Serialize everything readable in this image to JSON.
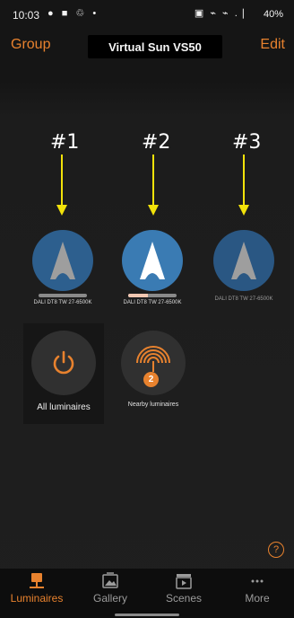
{
  "status_bar": {
    "time": "10:03",
    "left_icons": "● ■ ♲ •",
    "right_icons": "▣ ⌁ ⌁ .❘",
    "battery": "40%"
  },
  "header": {
    "group_label": "Group",
    "title": "Virtual Sun VS50",
    "edit_label": "Edit"
  },
  "annotations": [
    {
      "label": "#1"
    },
    {
      "label": "#2"
    },
    {
      "label": "#3"
    }
  ],
  "annotation_color": "#f2e20a",
  "luminaires": [
    {
      "label": "DALI DT8 TW 27-6500K",
      "level": 0.0,
      "state": "off",
      "icon": "luminaire-shape-icon"
    },
    {
      "label": "DALI DT8 TW 27-6500K",
      "level": 0.4,
      "state": "on",
      "icon": "luminaire-shape-icon"
    },
    {
      "label": "DALI DT8 TW 27-6500K",
      "level": null,
      "state": "unreachable",
      "icon": "luminaire-shape-icon"
    }
  ],
  "all_luminaires": {
    "label": "All luminaires",
    "icon": "power-icon"
  },
  "nearby_luminaires": {
    "label": "Nearby luminaires",
    "count": "2",
    "icon": "nearby-signal-icon"
  },
  "help": {
    "symbol": "?"
  },
  "nav": [
    {
      "label": "Luminaires",
      "icon": "lamp-icon",
      "active": true
    },
    {
      "label": "Gallery",
      "icon": "gallery-icon",
      "active": false
    },
    {
      "label": "Scenes",
      "icon": "clapper-icon",
      "active": false
    },
    {
      "label": "More",
      "icon": "more-dots-icon",
      "active": false
    }
  ],
  "colors": {
    "accent": "#e8822e",
    "luminaire_blue": "#2d5f8e",
    "luminaire_active_blue": "#3a7bb3",
    "level_fill": "#f1c7b1"
  }
}
